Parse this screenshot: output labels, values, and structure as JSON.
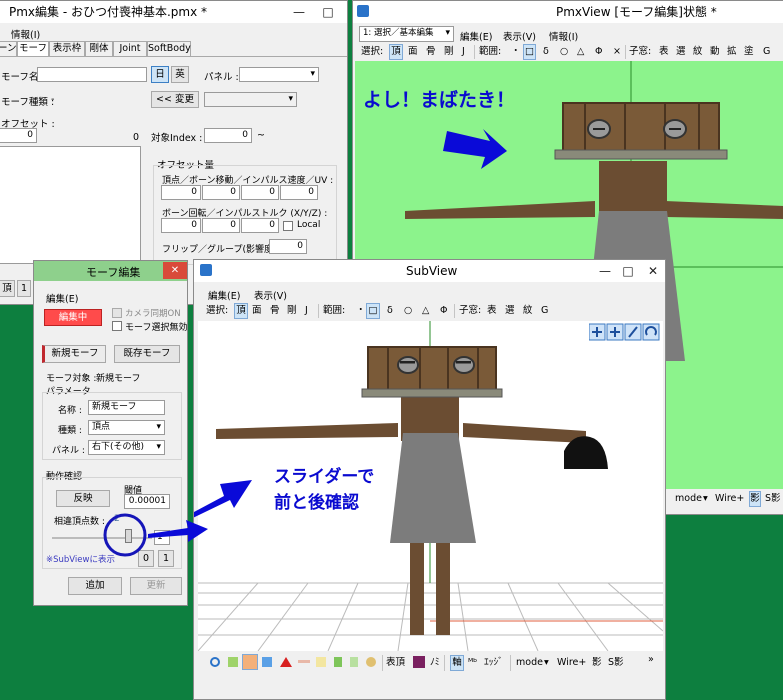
{
  "desktop": {
    "accent": "#0d7f3f"
  },
  "pmx": {
    "title": "Pmx編集 - おひつ付喪神基本.pmx *",
    "menu": [
      "情報(I)"
    ],
    "tabs": [
      "ーン",
      "モーフ",
      "表示枠",
      "剛体",
      "Joint",
      "SoftBody"
    ],
    "morph_name_label": "モーフ名 :",
    "jp_btn": "日",
    "en_btn": "英",
    "panel_label": "パネル :",
    "morph_type_label": "モーフ種類 :",
    "morph_type_value": "-",
    "change_btn": "<< 変更",
    "offset_label": "オフセット :",
    "offset_value": "0",
    "offset_right": "0",
    "target_index_label": "対象Index :",
    "target_index_value": "0",
    "target_index_dash": "~",
    "offset_amount_group": "オフセット量",
    "vertex_label": "頂点／ボーン移動／インパルス速度／UV :",
    "vertex_values": [
      "0",
      "0",
      "0",
      "0"
    ],
    "bone_rot_label": "ボーン回転／インパルストルク (X/Y/Z) :",
    "bone_rot_values": [
      "0",
      "0",
      "0"
    ],
    "local_label": "Local",
    "flip_label": "フリップ／グループ(影響度) :",
    "flip_value": "0",
    "bottom_btns": [
      "頂",
      "1"
    ]
  },
  "pmxview": {
    "title": "PmxView [モーフ編集]状態 *",
    "mode_select": "1: 選択／基本編集",
    "menu": [
      "編集(E)",
      "表示(V)",
      "情報(I)"
    ],
    "toolbar": [
      "選択:",
      "頂",
      "面",
      "骨",
      "剛",
      "J",
      "範囲:",
      "・",
      "□",
      "δ",
      "○",
      "△",
      "Φ",
      "×",
      "子窓:",
      "表",
      "選",
      "紋",
      "動",
      "拡",
      "塗",
      "G"
    ],
    "annotation": "よし！まばたき！",
    "statusbar": [
      "mode",
      "Wire+",
      "影",
      "S影"
    ],
    "bg_color": "#8cf38c"
  },
  "morph_dialog": {
    "title": "モーフ編集",
    "menu": "編集(E)",
    "camera_sync": "カメラ同期ON",
    "editing_btn": "編集中",
    "morph_select_disable": "モーフ選択無効",
    "new_morph_btn": "新規モーフ",
    "existing_morph_btn": "既存モーフ",
    "morph_target_label": "モーフ対象 :",
    "morph_target_value": "新規モーフ",
    "params_group": "パラメータ",
    "name_label": "名称 :",
    "name_value": "新規モーフ",
    "kind_label": "種類 :",
    "kind_value": "頂点",
    "panel_label": "パネル :",
    "panel_value": "右下(その他)",
    "check_group": "動作確認",
    "invert_btn": "反映",
    "threshold_label": "閾値",
    "threshold_value": "0.00001",
    "diff_vertex_label": "相違頂点数 :",
    "diff_vertex_value": "2",
    "slider_min": "0",
    "slider_max": "1",
    "subview_note": "※SubViewに表示",
    "add_btn": "追加",
    "update_btn": "更新"
  },
  "subview": {
    "title": "SubView",
    "menu": [
      "編集(E)",
      "表示(V)"
    ],
    "toolbar": [
      "選択:",
      "頂",
      "面",
      "骨",
      "剛",
      "J",
      "範囲:",
      "・",
      "□",
      "δ",
      "○",
      "△",
      "Φ",
      "子窓:",
      "表",
      "選",
      "紋",
      "G"
    ],
    "annotation_line1": "スライダーで",
    "annotation_line2": "前と後確認",
    "bottom_bar": [
      "表頂",
      "ﾉﾐ",
      "軸",
      "ｴｯｼﾞ",
      "mode",
      "Wire+",
      "影",
      "S影"
    ]
  }
}
